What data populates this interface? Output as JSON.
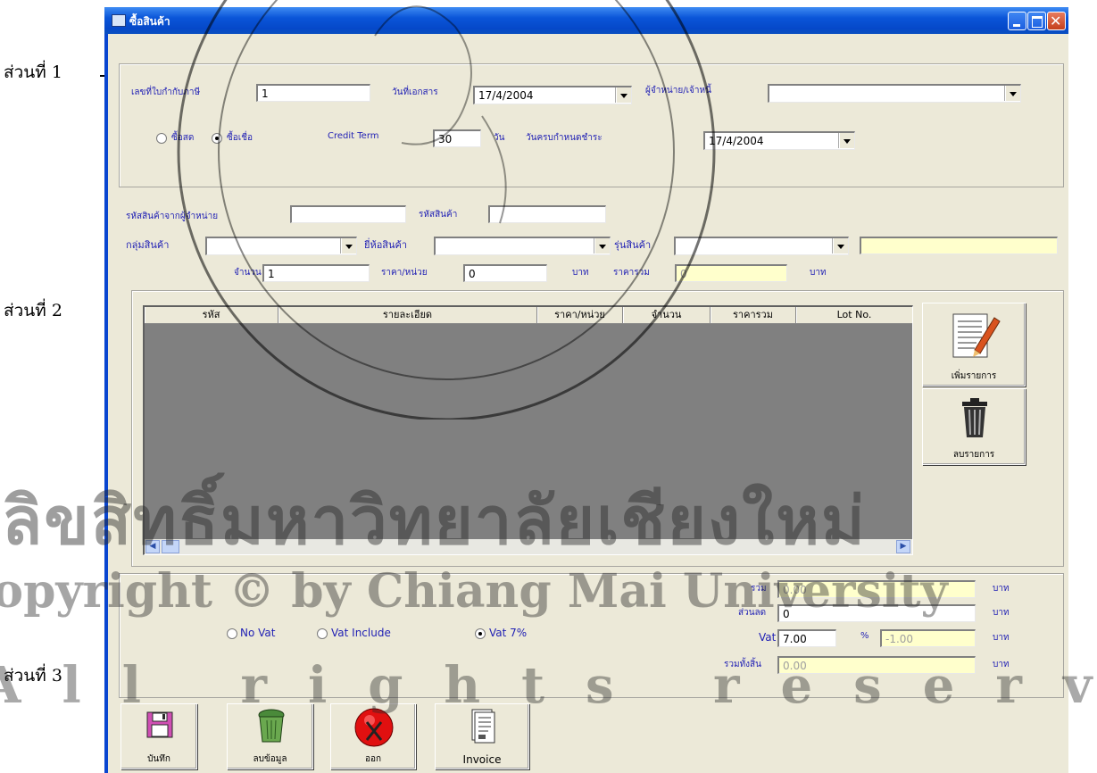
{
  "callouts": [
    "ส่วนที่ 1",
    "ส่วนที่ 2",
    "ส่วนที่ 3"
  ],
  "window": {
    "title": "ซื้อสินค้า"
  },
  "section1": {
    "invoice_no_label": "เลขที่ใบกำกับภาษี",
    "invoice_no_value": "1",
    "doc_date_label": "วันที่เอกสาร",
    "doc_date_value": "17/4/2004",
    "supplier_label": "ผู้จำหน่าย/เจ้าหนี้",
    "supplier_value": "",
    "pay_cash_label": "ซื้อสด",
    "pay_credit_label": "ซื้อเชื่อ",
    "credit_term_label": "Credit Term",
    "credit_term_value": "30",
    "credit_term_unit": "วัน",
    "due_date_label": "วันครบกำหนดชำระ",
    "due_date_value": "17/4/2004"
  },
  "section2": {
    "supplier_code_label": "รหัสสินค้าจากผู้จำหน่าย",
    "supplier_code_value": "",
    "product_code_label": "รหัสสินค้า",
    "product_code_value": "",
    "group_label": "กลุ่มสินค้า",
    "brand_label": "ยี่ห้อสินค้า",
    "model_label": "รุ่นสินค้า",
    "qty_label": "จำนวน",
    "qty_value": "1",
    "unit_price_label": "ราคา/หน่วย",
    "unit_price_value": "0",
    "baht": "บาท",
    "total_label": "ราคารวม",
    "total_value": "0",
    "grid_columns": [
      "รหัส",
      "รายละเอียด",
      "ราคา/หน่วย",
      "จำนวน",
      "ราคารวม",
      "Lot No."
    ],
    "add_item_label": "เพิ่มรายการ",
    "delete_item_label": "ลบรายการ"
  },
  "section3": {
    "vat_options": [
      "No Vat",
      "Vat Include",
      "Vat 7%"
    ],
    "selected_vat": "Vat 7%",
    "sum_label": "รวม",
    "sum_value": "0.00",
    "discount_label": "ส่วนลด",
    "discount_value": "0",
    "vat_label": "Vat",
    "vat_rate_value": "7.00",
    "percent": "%",
    "vat_amount_value": "-1.00",
    "grand_total_label": "รวมทั้งสิ้น",
    "grand_total_value": "0.00",
    "baht": "บาท"
  },
  "toolbar": {
    "save_label": "บันทึก",
    "clear_label": "ลบข้อมูล",
    "exit_label": "ออก",
    "invoice_label": "Invoice"
  },
  "watermark": {
    "line1": "ลิขสิทธิ์มหาวิทยาลัยเชียงใหม่",
    "line2": "Copyright © by Chiang Mai University",
    "line3": "All rights reserved"
  },
  "colors": {
    "titlebar": "#0a55d8",
    "label": "#1f1fb4",
    "readonly_field": "#ffffcc",
    "grid_bg": "#808080"
  }
}
